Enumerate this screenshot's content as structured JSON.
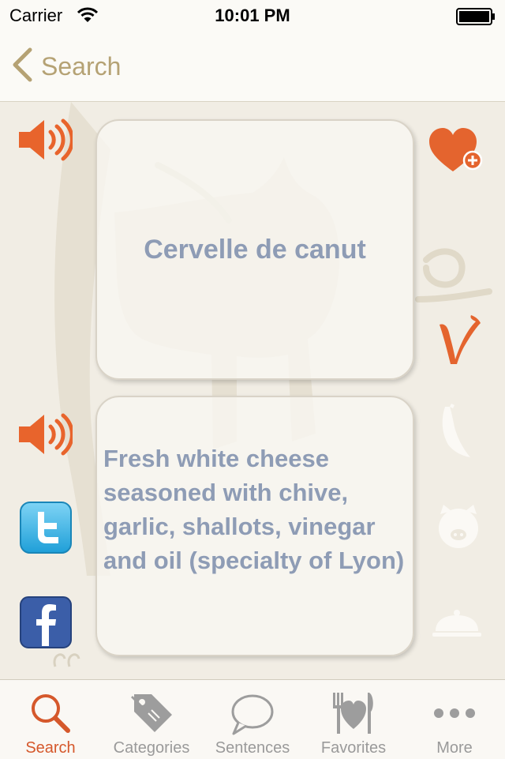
{
  "status_bar": {
    "carrier": "Carrier",
    "time": "10:01 PM"
  },
  "nav": {
    "back_label": "Search"
  },
  "term": {
    "text": "Cervelle de canut"
  },
  "definition": {
    "text": "Fresh white cheese seasoned with chive, garlic, shallots, vinegar and oil (specialty of Lyon)"
  },
  "tabs": [
    {
      "label": "Search",
      "icon": "search-icon",
      "active": true
    },
    {
      "label": "Categories",
      "icon": "tag-icon",
      "active": false
    },
    {
      "label": "Sentences",
      "icon": "speech-bubble-icon",
      "active": false
    },
    {
      "label": "Favorites",
      "icon": "heart-cutlery-icon",
      "active": false
    },
    {
      "label": "More",
      "icon": "more-icon",
      "active": false
    }
  ],
  "colors": {
    "accent": "#d5582b",
    "nav_tint": "#b5a274",
    "card_text": "#8e9cb5",
    "background": "#f1ede4"
  }
}
